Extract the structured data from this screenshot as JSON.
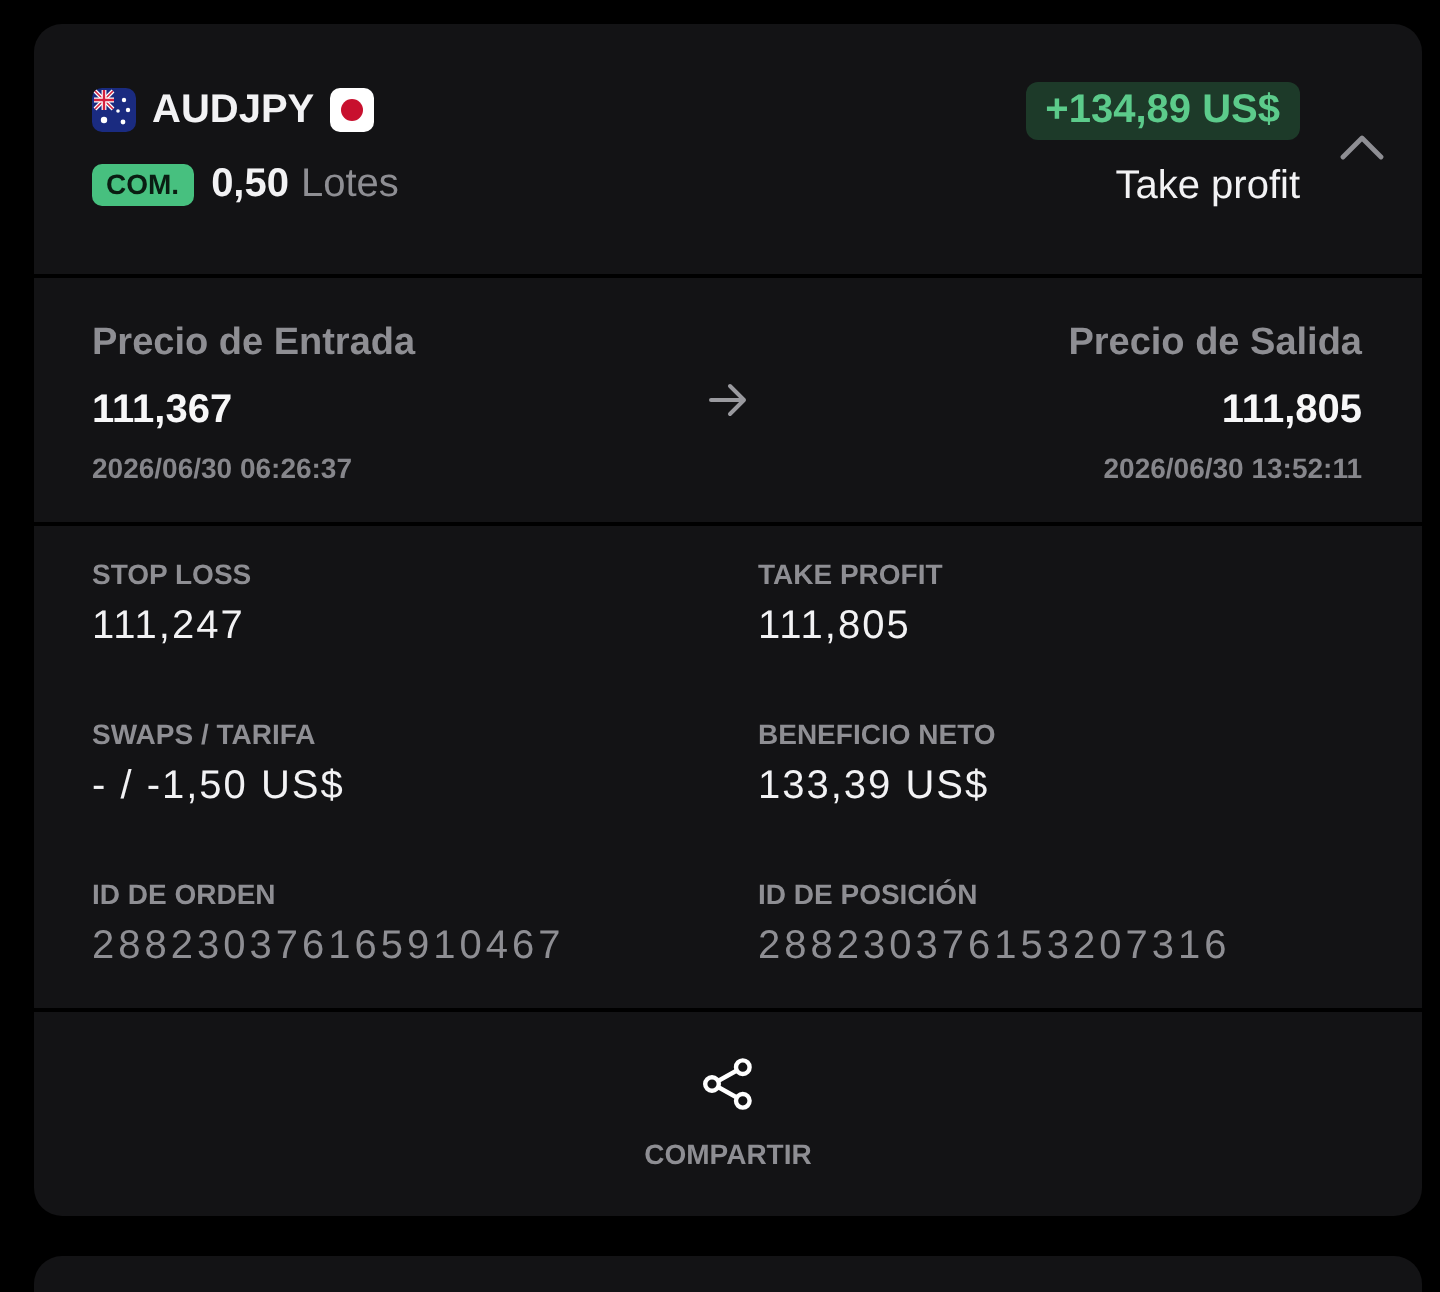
{
  "trade": {
    "symbol": "AUDJPY",
    "type_badge": "COM.",
    "volume": "0,50",
    "volume_unit": "Lotes",
    "profit": "+134,89 US$",
    "profit_positive": true,
    "close_reason": "Take profit",
    "expanded": true
  },
  "prices": [
    {
      "label": "Precio de Entrada",
      "price": "111,367",
      "time": "2026/06/30 06:26:37"
    },
    {
      "label": "Precio de Salida",
      "price": "111,805",
      "time": "2026/06/30 13:52:11"
    }
  ],
  "details": [
    {
      "label": "STOP LOSS",
      "value": "111,247",
      "kind": "value"
    },
    {
      "label": "TAKE PROFIT",
      "value": "111,805",
      "kind": "value"
    },
    {
      "label": "SWAPS / TARIFA",
      "value": "- / -1,50 US$",
      "kind": "value"
    },
    {
      "label": "BENEFICIO NETO",
      "value": "133,39 US$",
      "kind": "value"
    },
    {
      "label": "ID DE ORDEN",
      "value": "288230376165910467",
      "kind": "id"
    },
    {
      "label": "ID DE POSICIÓN",
      "value": "288230376153207316",
      "kind": "id"
    }
  ],
  "share_button": {
    "label": "COMPARTIR"
  }
}
